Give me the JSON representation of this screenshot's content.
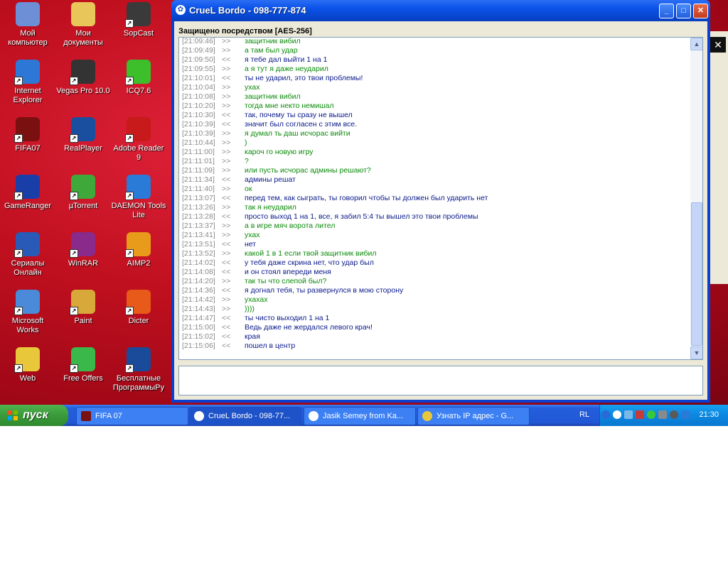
{
  "desktop": {
    "icons": [
      {
        "label": "Мой компьютер",
        "icon": "my-computer-icon",
        "color": "#6c8fd6"
      },
      {
        "label": "Мои документы",
        "icon": "my-documents-icon",
        "color": "#e8c65a"
      },
      {
        "label": "SopCast",
        "icon": "sopcast-icon",
        "color": "#3a3a3a"
      },
      {
        "label": "Internet Explorer",
        "icon": "internet-explorer-icon",
        "color": "#2d78d6"
      },
      {
        "label": "Vegas Pro 10.0",
        "icon": "vegas-pro-icon",
        "color": "#333333"
      },
      {
        "label": "ICQ7.6",
        "icon": "icq-icon",
        "color": "#3cbf2a"
      },
      {
        "label": "FIFA07",
        "icon": "fifa07-icon",
        "color": "#7a1010"
      },
      {
        "label": "RealPlayer",
        "icon": "realplayer-icon",
        "color": "#1a4fa0"
      },
      {
        "label": "Adobe Reader 9",
        "icon": "adobe-reader-icon",
        "color": "#c81a1a"
      },
      {
        "label": "GameRanger",
        "icon": "gameranger-icon",
        "color": "#1a3ea8"
      },
      {
        "label": "µTorrent",
        "icon": "utorrent-icon",
        "color": "#3ea83a"
      },
      {
        "label": "DAEMON Tools Lite",
        "icon": "daemon-tools-icon",
        "color": "#2a7ad8"
      },
      {
        "label": "Сериалы Онлайн",
        "icon": "tv-icon",
        "color": "#2a5ab8"
      },
      {
        "label": "WinRAR",
        "icon": "winrar-icon",
        "color": "#8a2a8a"
      },
      {
        "label": "AIMP2",
        "icon": "aimp-icon",
        "color": "#e89a1a"
      },
      {
        "label": "Microsoft Works",
        "icon": "microsoft-works-icon",
        "color": "#4a8ad8"
      },
      {
        "label": "Paint",
        "icon": "paint-icon",
        "color": "#d8a83a"
      },
      {
        "label": "Dicter",
        "icon": "dicter-icon",
        "color": "#e85a1a"
      },
      {
        "label": "Web",
        "icon": "web-icon",
        "color": "#e8c83a"
      },
      {
        "label": "Free Offers",
        "icon": "gift-icon",
        "color": "#3ab84a"
      },
      {
        "label": "Бесплатные ПрограммыРу",
        "icon": "bp-icon",
        "color": "#1a4a9a"
      }
    ]
  },
  "window": {
    "title": "CrueL Bordo - 098-777-874",
    "security_label": "Защищено посредством [AES-256]",
    "messages": [
      {
        "ts": "[21:09:46]",
        "dir": ">>",
        "text": "защитник вибил",
        "kind": "out"
      },
      {
        "ts": "[21:09:49]",
        "dir": ">>",
        "text": "а там был удар",
        "kind": "out"
      },
      {
        "ts": "[21:09:50]",
        "dir": "<<",
        "text": "я тебе дал выйти 1 на 1",
        "kind": "in"
      },
      {
        "ts": "[21:09:55]",
        "dir": ">>",
        "text": "а я тут я даже неударил",
        "kind": "out"
      },
      {
        "ts": "[21:10:01]",
        "dir": "<<",
        "text": "ты не ударил, это твои проблемы!",
        "kind": "in"
      },
      {
        "ts": "[21:10:04]",
        "dir": ">>",
        "text": "ухах",
        "kind": "out"
      },
      {
        "ts": "[21:10:08]",
        "dir": ">>",
        "text": "защитник вибил",
        "kind": "out"
      },
      {
        "ts": "[21:10:20]",
        "dir": ">>",
        "text": "тогда мне некто немишал",
        "kind": "out"
      },
      {
        "ts": "[21:10:30]",
        "dir": "<<",
        "text": "так, почему ты сразу не вышел",
        "kind": "in"
      },
      {
        "ts": "[21:10:39]",
        "dir": "<<",
        "text": "значит был согласен с этим все.",
        "kind": "in"
      },
      {
        "ts": "[21:10:39]",
        "dir": ">>",
        "text": "я думал ть даш исчорас вийти",
        "kind": "out"
      },
      {
        "ts": "[21:10:44]",
        "dir": ">>",
        "text": ")",
        "kind": "out"
      },
      {
        "ts": "[21:11:00]",
        "dir": ">>",
        "text": "кароч го новую игру",
        "kind": "out"
      },
      {
        "ts": "[21:11:01]",
        "dir": ">>",
        "text": "?",
        "kind": "out"
      },
      {
        "ts": "[21:11:09]",
        "dir": ">>",
        "text": "или пусть исчорас админы решают?",
        "kind": "out"
      },
      {
        "ts": "[21:11:34]",
        "dir": "<<",
        "text": "админы решат",
        "kind": "in"
      },
      {
        "ts": "[21:11:40]",
        "dir": ">>",
        "text": "ок",
        "kind": "out"
      },
      {
        "ts": "[21:13:07]",
        "dir": "<<",
        "text": "перед тем, как сыграть, ты говорил чтобы ты должен был ударить нет",
        "kind": "in"
      },
      {
        "ts": "[21:13:26]",
        "dir": ">>",
        "text": "так я неударил",
        "kind": "out"
      },
      {
        "ts": "[21:13:28]",
        "dir": "<<",
        "text": "просто выход 1 на 1, все, я забил 5:4 ты вышел это твои проблемы",
        "kind": "in"
      },
      {
        "ts": "[21:13:37]",
        "dir": ">>",
        "text": "а в игре мяч ворота лител",
        "kind": "out"
      },
      {
        "ts": "[21:13:41]",
        "dir": ">>",
        "text": "ухах",
        "kind": "out"
      },
      {
        "ts": "[21:13:51]",
        "dir": "<<",
        "text": "нет",
        "kind": "in"
      },
      {
        "ts": "[21:13:52]",
        "dir": ">>",
        "text": "какой 1 в 1 если твой защитник вибил",
        "kind": "out"
      },
      {
        "ts": "[21:14:02]",
        "dir": "<<",
        "text": "у тебя даже скрина нет, что удар был",
        "kind": "in"
      },
      {
        "ts": "[21:14:08]",
        "dir": "<<",
        "text": "и он стоял впереди меня",
        "kind": "in"
      },
      {
        "ts": "[21:14:20]",
        "dir": ">>",
        "text": "так ты что слепой был?",
        "kind": "out"
      },
      {
        "ts": "[21:14:36]",
        "dir": "<<",
        "text": "я догнал тебя, ты развернулся в мою сторону",
        "kind": "in"
      },
      {
        "ts": "[21:14:42]",
        "dir": ">>",
        "text": "ухахах",
        "kind": "out"
      },
      {
        "ts": "[21:14:43]",
        "dir": ">>",
        "text": "))))",
        "kind": "out"
      },
      {
        "ts": "[21:14:47]",
        "dir": "<<",
        "text": "ты чисто выходил 1 на 1",
        "kind": "in"
      },
      {
        "ts": "[21:15:00]",
        "dir": "<<",
        "text": "Ведь даже не жердался левого крач!",
        "kind": "in"
      },
      {
        "ts": "[21:15:02]",
        "dir": "<<",
        "text": "края",
        "kind": "in"
      },
      {
        "ts": "[21:15:06]",
        "dir": "<<",
        "text": "пошел в центр",
        "kind": "in"
      }
    ],
    "input_value": ""
  },
  "taskbar": {
    "start_label": "пуск",
    "tasks": [
      {
        "label": "FIFA 07",
        "icon": "fifa07-icon",
        "color": "#7a1010"
      },
      {
        "label": "CrueL Bordo - 098-77...",
        "icon": "qip-icon",
        "color": "#ffffff"
      },
      {
        "label": "Jasik Semey from  Ka...",
        "icon": "qip-icon",
        "color": "#ffffff"
      },
      {
        "label": "Узнать IP адрес - G...",
        "icon": "chrome-icon",
        "color": "#e8c83a"
      }
    ],
    "lang": "RL",
    "clock": "21:30"
  },
  "colors": {
    "outgoing_text": "#0a8a0a",
    "incoming_text": "#0a1a8a",
    "timestamp": "#8a8a8a"
  }
}
